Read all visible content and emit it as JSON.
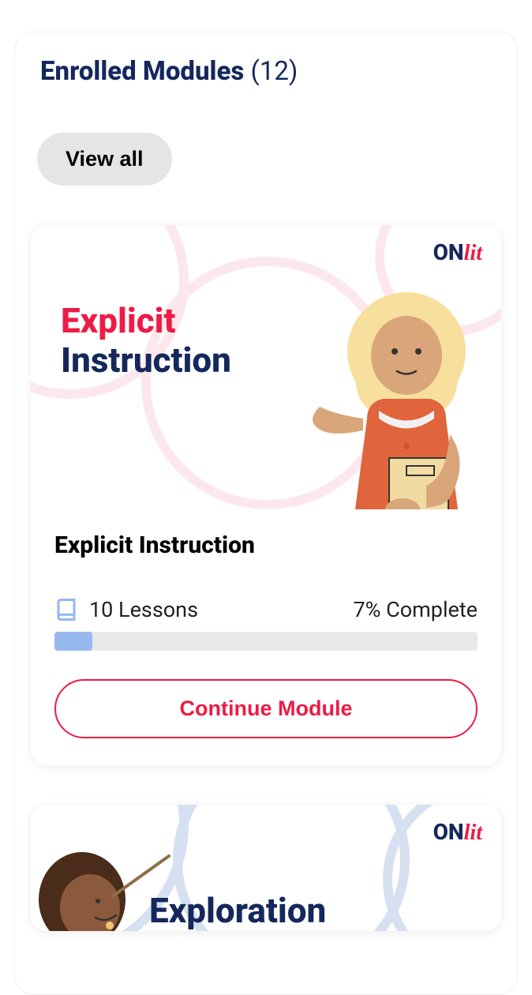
{
  "header": {
    "title": "Enrolled Modules",
    "count": "(12)",
    "view_all_label": "View all"
  },
  "brand": {
    "on": "ON",
    "lit": "lit"
  },
  "modules": [
    {
      "image_title_line1": "Explicit",
      "image_title_line2": "Instruction",
      "title": "Explicit Instruction",
      "lessons_count": "10 Lessons",
      "complete_text": "7% Complete",
      "progress_percent": 7,
      "continue_label": "Continue Module"
    },
    {
      "image_title_line1": "Exploration"
    }
  ]
}
